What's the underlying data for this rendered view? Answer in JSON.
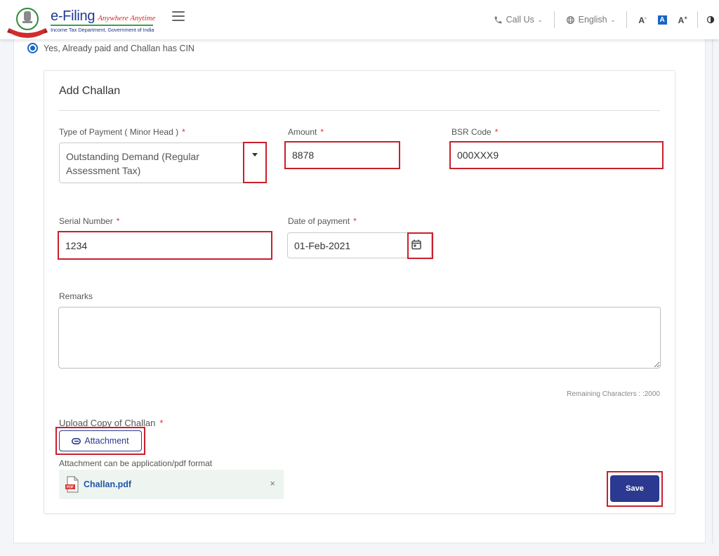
{
  "header": {
    "brand_name": "e-Filing",
    "brand_tagline": "Anywhere Anytime",
    "brand_subtitle": "Income Tax Department, Government of India",
    "call_us_label": "Call Us",
    "language_label": "English",
    "font_decrease_label": "A",
    "font_decrease_sup": "-",
    "font_default_label": "A",
    "font_increase_label": "A",
    "font_increase_sup": "+",
    "icons": {
      "logo": "emblem-icon",
      "menu": "hamburger-icon",
      "call": "phone-icon",
      "language": "globe-icon",
      "contrast": "contrast-icon"
    }
  },
  "payment_option": {
    "label": "Yes, Already paid and Challan has CIN",
    "selected": true
  },
  "form": {
    "title": "Add Challan",
    "type_of_payment": {
      "label": "Type of Payment ( Minor Head )",
      "required_mark": "*",
      "value": "Outstanding Demand (Regular Assessment Tax)"
    },
    "amount": {
      "label": "Amount",
      "required_mark": "*",
      "value": "8878"
    },
    "bsr_code": {
      "label": "BSR Code",
      "required_mark": "*",
      "value": "000XXX9"
    },
    "serial_number": {
      "label": "Serial Number",
      "required_mark": "*",
      "value": "1234"
    },
    "date_of_payment": {
      "label": "Date of payment",
      "required_mark": "*",
      "value": "01-Feb-2021"
    },
    "remarks": {
      "label": "Remarks",
      "value": "",
      "remaining_text": "Remaining Characters : :2000"
    },
    "upload": {
      "label": "Upload Copy of Challan",
      "required_mark": "*",
      "button_label": "Attachment",
      "hint": "Attachment can be application/pdf format",
      "file_name": "Challan.pdf",
      "remove_label": "×"
    },
    "save_label": "Save"
  },
  "colors": {
    "primary": "#2b3990",
    "accent_blue": "#1b64c4",
    "highlight_red": "#c8202c",
    "file_chip_bg": "#eef5f0"
  }
}
